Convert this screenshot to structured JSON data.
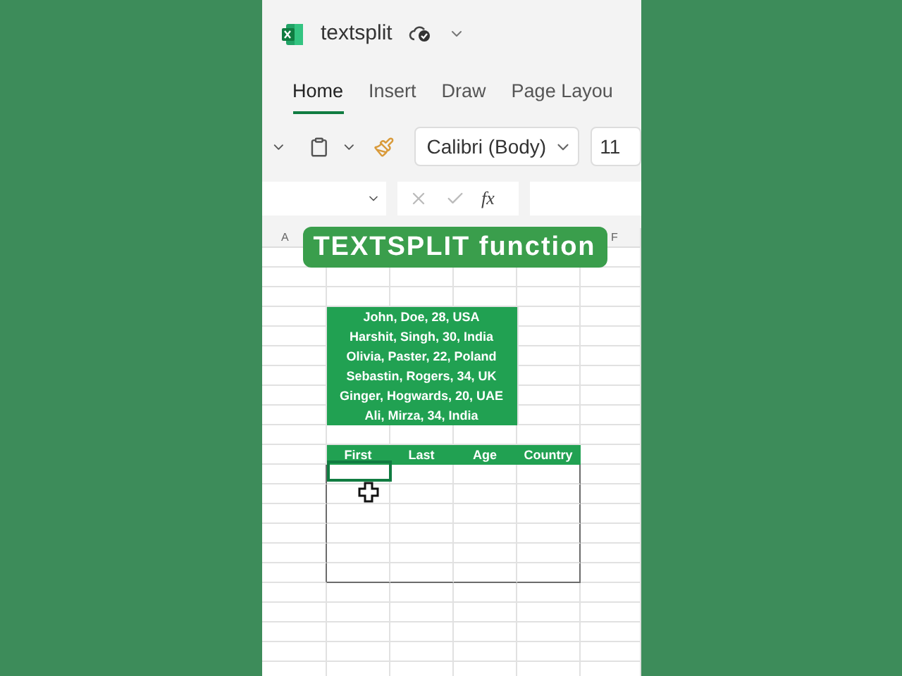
{
  "document": {
    "title": "textsplit"
  },
  "tabs": [
    {
      "label": "Home",
      "selected": true
    },
    {
      "label": "Insert",
      "selected": false
    },
    {
      "label": "Draw",
      "selected": false
    },
    {
      "label": "Page Layou",
      "selected": false
    }
  ],
  "toolbar": {
    "font": "Calibri (Body)",
    "font_size": "11"
  },
  "formula_bar": {
    "function_label": "fx"
  },
  "column_headers": [
    "A",
    "F"
  ],
  "overlay_title": "TEXTSPLIT function",
  "source_lines": [
    "John, Doe, 28, USA",
    "Harshit, Singh, 30, India",
    "Olivia, Paster, 22, Poland",
    "Sebastin, Rogers, 34, UK",
    "Ginger, Hogwards, 20, UAE",
    "Ali, Mirza, 34, India"
  ],
  "table": {
    "columns": [
      "First",
      "Last",
      "Age",
      "Country"
    ]
  }
}
